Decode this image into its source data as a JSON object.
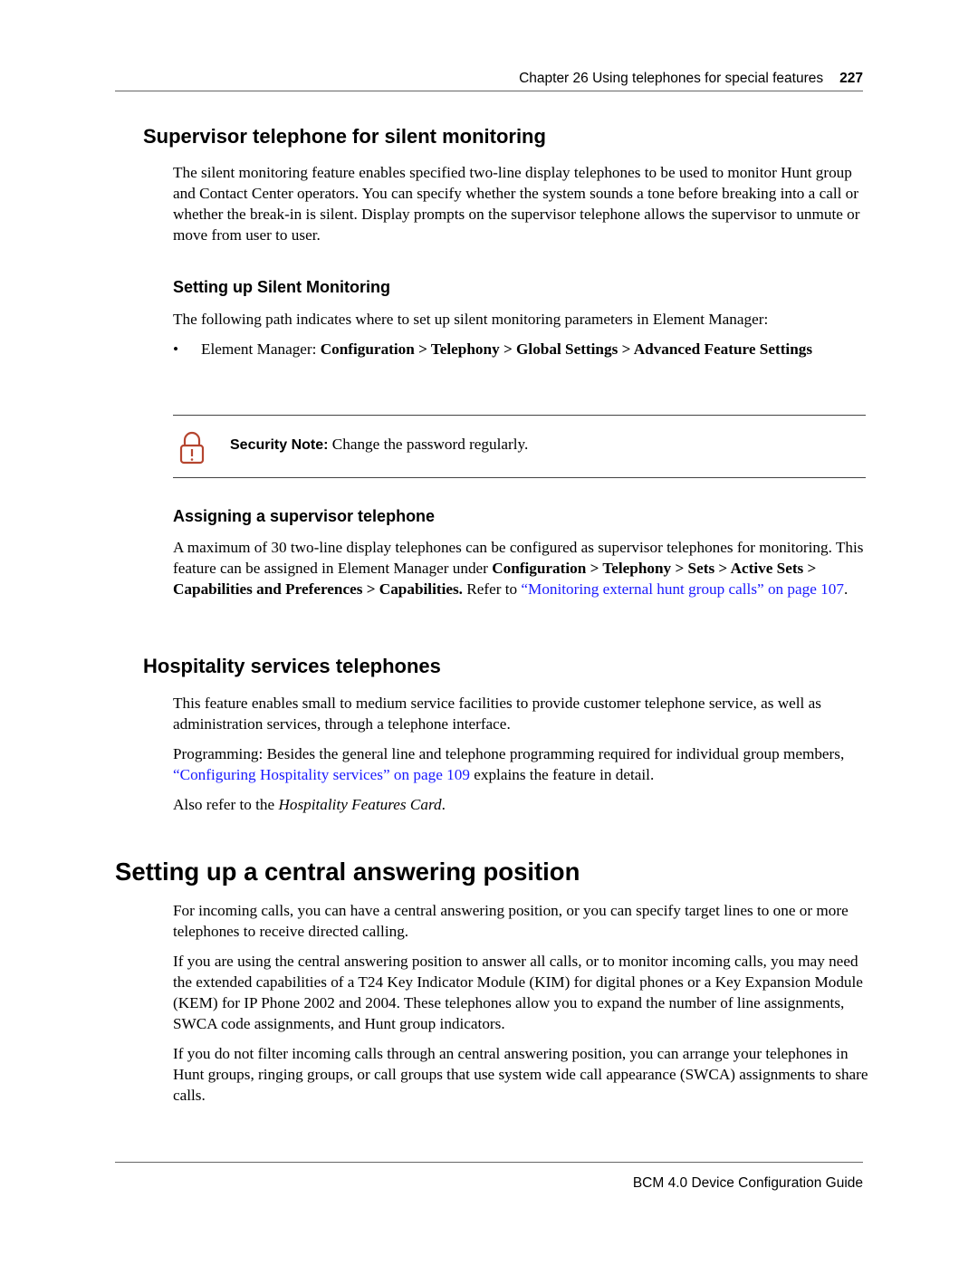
{
  "header": {
    "chapter": "Chapter 26  Using telephones for special features",
    "page_number": "227"
  },
  "section_supervisor": {
    "title": "Supervisor telephone for silent monitoring",
    "body": "The silent monitoring feature enables specified two-line display telephones to be used to monitor Hunt group and Contact Center operators. You can specify whether the system sounds a tone before breaking into a call or whether the break-in is silent. Display prompts on the supervisor telephone allows the supervisor to unmute or move from user to user."
  },
  "subsection_setup": {
    "title": "Setting up Silent Monitoring",
    "body": "The following path indicates where to set up silent monitoring parameters in Element Manager:",
    "bullet": {
      "symbol": "•",
      "prefix": "Element Manager: ",
      "path": "Configuration > Telephony > Global Settings > Advanced Feature Settings"
    }
  },
  "security_note": {
    "icon": "padlock-warning-icon",
    "icon_color": "#b5452f",
    "label": "Security Note:",
    "text": " Change the password regularly."
  },
  "subsection_assign": {
    "title": "Assigning a supervisor telephone",
    "body_start": "A maximum of 30 two-line display telephones can be configured as supervisor telephones for monitoring. This feature can be assigned in Element Manager under ",
    "path": "Configuration > Telephony > Sets > Active Sets > Capabilities and Preferences > Capabilities.",
    "refer": " Refer to ",
    "link": "“Monitoring external hunt group calls” on page 107",
    "end": "."
  },
  "section_hospitality": {
    "title": "Hospitality services telephones",
    "para1": "This feature enables small to medium service facilities to provide customer telephone service, as well as administration services, through a telephone interface.",
    "para2_start": "Programming: Besides the general line and telephone programming required for individual group members, ",
    "para2_link": "“Configuring Hospitality services” on page 109",
    "para2_end": " explains the feature in detail.",
    "para3_start": "Also refer to the ",
    "para3_italic": "Hospitality Features Card",
    "para3_end": "."
  },
  "section_central": {
    "title": "Setting up a central answering position",
    "para1": "For incoming calls, you can have a central answering position, or you can specify target lines to one or more telephones to receive directed calling.",
    "para2": "If you are using the central answering position to answer all calls, or to monitor incoming calls, you may need the extended capabilities of a T24 Key Indicator Module (KIM) for digital phones or a Key Expansion Module (KEM) for IP Phone 2002 and 2004. These telephones allow you to expand the number of line assignments, SWCA code assignments, and Hunt group indicators.",
    "para3": "If you do not filter incoming calls through an central answering position, you can arrange your telephones in Hunt groups, ringing groups, or call groups that use system wide call appearance (SWCA) assignments to share calls."
  },
  "colors": {
    "link": "#1a1aff",
    "rule": "#666666"
  },
  "footer": {
    "title": "BCM 4.0 Device Configuration Guide"
  }
}
